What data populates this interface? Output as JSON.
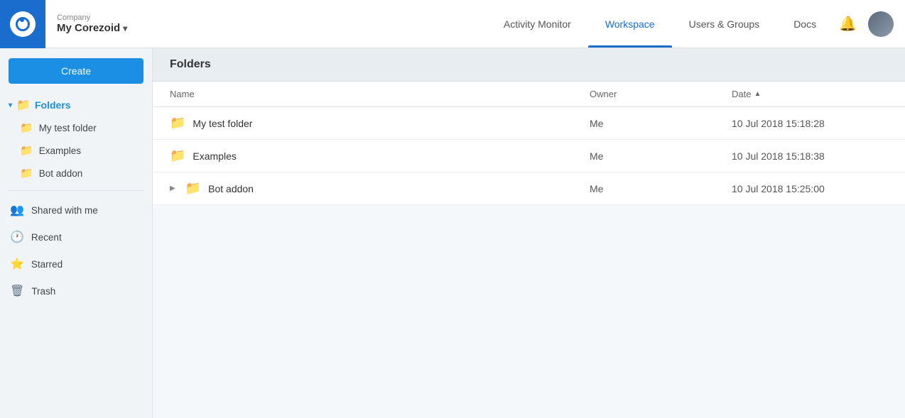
{
  "header": {
    "company_label": "Company",
    "company_name": "My Corezoid",
    "nav": [
      {
        "id": "activity-monitor",
        "label": "Activity Monitor",
        "active": false
      },
      {
        "id": "workspace",
        "label": "Workspace",
        "active": true
      },
      {
        "id": "users-groups",
        "label": "Users & Groups",
        "active": false
      },
      {
        "id": "docs",
        "label": "Docs",
        "active": false
      }
    ]
  },
  "sidebar": {
    "create_label": "Create",
    "folders_label": "Folders",
    "sub_folders": [
      {
        "id": "my-test-folder",
        "label": "My test folder"
      },
      {
        "id": "examples",
        "label": "Examples"
      },
      {
        "id": "bot-addon",
        "label": "Bot addon"
      }
    ],
    "nav_items": [
      {
        "id": "shared-with-me",
        "label": "Shared with me",
        "icon": "👥"
      },
      {
        "id": "recent",
        "label": "Recent",
        "icon": "🕐"
      },
      {
        "id": "starred",
        "label": "Starred",
        "icon": "⭐"
      },
      {
        "id": "trash",
        "label": "Trash",
        "icon": "🗑"
      }
    ]
  },
  "main": {
    "section_title": "Folders",
    "table": {
      "columns": [
        {
          "id": "name",
          "label": "Name"
        },
        {
          "id": "owner",
          "label": "Owner"
        },
        {
          "id": "date",
          "label": "Date",
          "sortable": true,
          "sort_dir": "asc"
        }
      ],
      "rows": [
        {
          "id": "row-1",
          "name": "My test folder",
          "owner": "Me",
          "date": "10 Jul 2018 15:18:28",
          "expandable": false
        },
        {
          "id": "row-2",
          "name": "Examples",
          "owner": "Me",
          "date": "10 Jul 2018 15:18:38",
          "expandable": false
        },
        {
          "id": "row-3",
          "name": "Bot addon",
          "owner": "Me",
          "date": "10 Jul 2018 15:25:00",
          "expandable": true
        }
      ]
    }
  },
  "colors": {
    "accent": "#1a8fe3",
    "active_nav": "#1a6dcc"
  }
}
